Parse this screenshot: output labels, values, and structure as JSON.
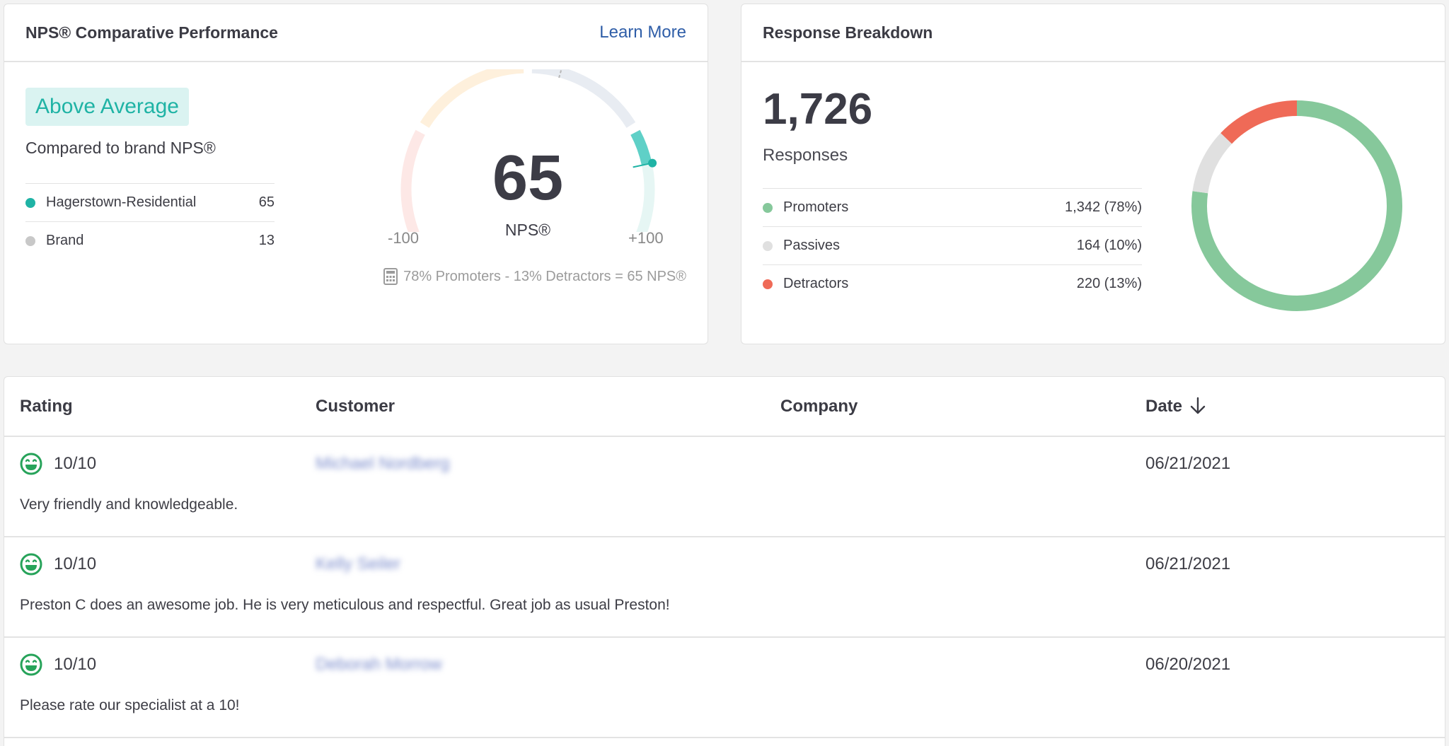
{
  "nps_card": {
    "title": "NPS® Comparative Performance",
    "learn_more": "Learn More",
    "badge": "Above Average",
    "compared_text": "Compared to brand NPS®",
    "comparisons": [
      {
        "name": "Hagerstown-Residential",
        "value": "65",
        "color": "#1fb3a5"
      },
      {
        "name": "Brand",
        "value": "13",
        "color": "#c8c8c8"
      }
    ],
    "gauge": {
      "value": "65",
      "label": "NPS®",
      "min_label": "-100",
      "max_label": "+100",
      "score": 65,
      "brand_score": 13,
      "range": [
        -100,
        100
      ]
    },
    "formula": "78% Promoters - 13% Detractors = 65 NPS®"
  },
  "response_card": {
    "title": "Response Breakdown",
    "count": "1,726",
    "count_label": "Responses",
    "rows": [
      {
        "name": "Promoters",
        "value": "1,342 (78%)",
        "color": "#86c89b",
        "share": 0.78
      },
      {
        "name": "Passives",
        "value": "164 (10%)",
        "color": "#e0e0e0",
        "share": 0.1
      },
      {
        "name": "Detractors",
        "value": "220 (13%)",
        "color": "#ef6a57",
        "share": 0.13
      }
    ]
  },
  "table": {
    "columns": {
      "rating": "Rating",
      "customer": "Customer",
      "company": "Company",
      "date": "Date"
    },
    "rows": [
      {
        "rating": "10/10",
        "customer": "Michael Nordberg",
        "company": "",
        "date": "06/21/2021",
        "comment": "Very friendly and knowledgeable."
      },
      {
        "rating": "10/10",
        "customer": "Kelly Seiler",
        "company": "",
        "date": "06/21/2021",
        "comment": "Preston C does an awesome job. He is very meticulous and respectful. Great job as usual Preston!"
      },
      {
        "rating": "10/10",
        "customer": "Deborah Morrow",
        "company": "",
        "date": "06/20/2021",
        "comment": "Please rate our specialist at a 10!"
      }
    ]
  },
  "icons": {
    "calculator": "calculator-icon",
    "sort": "arrow-down-icon",
    "rating": "smiley-icon"
  },
  "colors": {
    "teal": "#1fb3a5",
    "promoter": "#86c89b",
    "passive": "#e0e0e0",
    "detractor": "#ef6a57",
    "link": "#2f5ea8"
  }
}
